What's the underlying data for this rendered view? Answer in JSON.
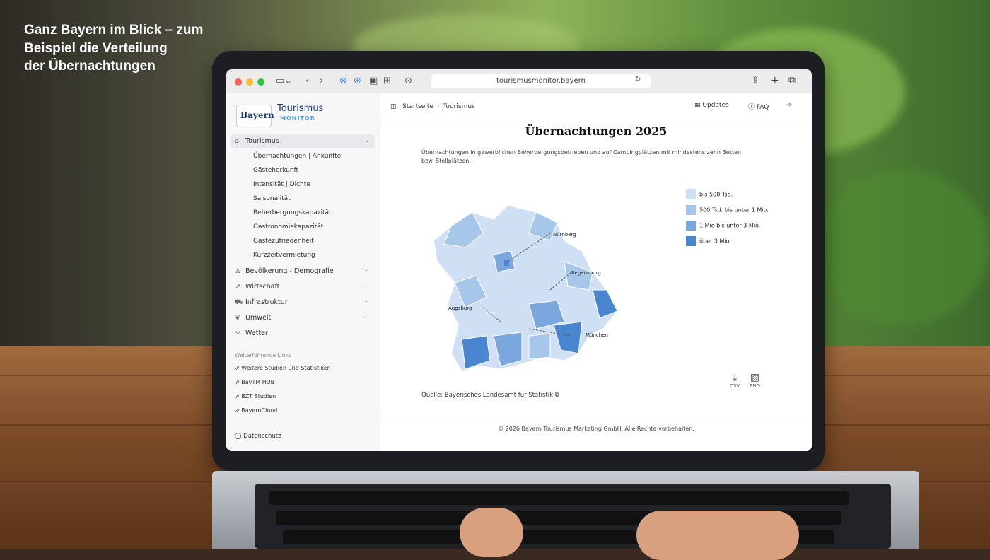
{
  "caption": [
    "Ganz Bayern im Blick – zum",
    "Beispiel die Verteilung",
    "der Übernachtungen"
  ],
  "browser": {
    "url": "tourismusmonitor.bayern"
  },
  "sidebar": {
    "logo": "Bayern",
    "brand_title": "Tourismus",
    "brand_sub": "MONITOR",
    "main_item": "Tourismus",
    "sub_items": [
      "Übernachtungen | Ankünfte",
      "Gästeherkunft",
      "Intensität | Dichte",
      "Saisonalität",
      "Beherbergungskapazität",
      "Gastronomiekapazität",
      "Gästezufriedenheit",
      "Kurzzeitvermietung"
    ],
    "items": [
      "Bevölkerung - Demografie",
      "Wirtschaft",
      "Infrastruktur",
      "Umwelt",
      "Wetter"
    ],
    "links_heading": "Weiterführende Links",
    "links": [
      "Weitere Studien und Statistiken",
      "BayTM HUB",
      "BZT Studien",
      "BayernCloud"
    ],
    "privacy": "Datenschutz"
  },
  "header": {
    "breadcrumb": [
      "Startseite",
      "Tourismus"
    ],
    "updates": "Updates",
    "faq": "FAQ"
  },
  "content": {
    "title": "Übernachtungen 2025",
    "description": "Übernachtungen in gewerblichen Beherbergungsbetrieben und auf Campingplätzen mit mindestens zehn Betten bzw. Stellplätzen.",
    "source": "Quelle: Bayerisches Landesamt für Statistik",
    "download_csv": "CSV",
    "download_png": "PNG",
    "footer": "© 2026 Bayern Tourismus Marketing GmbH. Alle Rechte vorbehalten."
  },
  "legend": [
    {
      "label": "bis 500 Tsd.",
      "color": "#cfe0f5"
    },
    {
      "label": "500 Tsd. bis unter 1 Mio.",
      "color": "#a6c6ea"
    },
    {
      "label": "1 Mio bis unter 3 Mio.",
      "color": "#7aa7de"
    },
    {
      "label": "über 3 Mio.",
      "color": "#4a86cf"
    }
  ],
  "map_labels": [
    "Nürnberg",
    "Regensburg",
    "Augsburg",
    "München"
  ]
}
